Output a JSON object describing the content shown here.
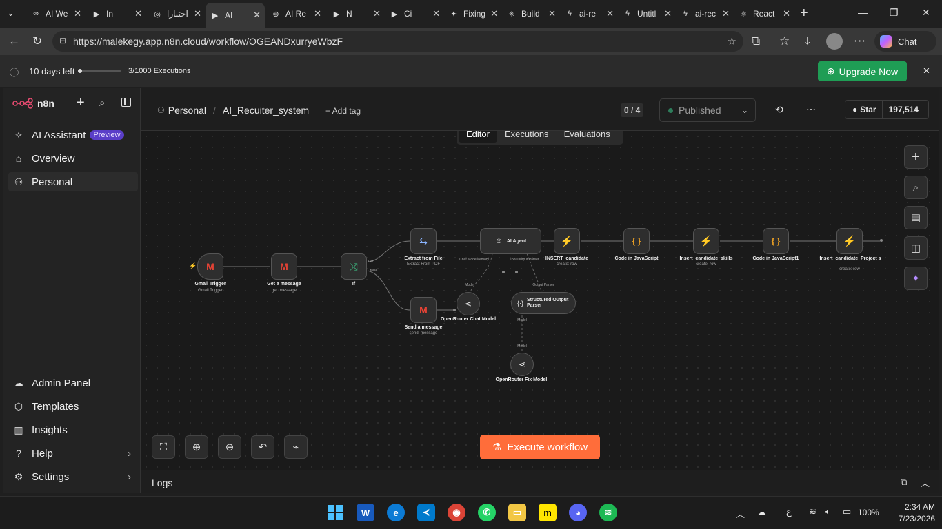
{
  "browser": {
    "tabs": [
      {
        "title": "AI We",
        "icon": "ai-favicon"
      },
      {
        "title": "In",
        "icon": "video-favicon"
      },
      {
        "title": "اختبارا",
        "icon": "quiz-favicon"
      },
      {
        "title": "AI",
        "icon": "video-favicon"
      },
      {
        "title": "AI Re",
        "icon": "chatgpt-favicon"
      },
      {
        "title": "N",
        "icon": "video-favicon"
      },
      {
        "title": "Ci",
        "icon": "video-favicon"
      },
      {
        "title": "Fixing",
        "icon": "gemini-favicon"
      },
      {
        "title": "Build",
        "icon": "claude-favicon"
      },
      {
        "title": "ai-re",
        "icon": "bolt-favicon"
      },
      {
        "title": "Untitl",
        "icon": "n8n-favicon"
      },
      {
        "title": "ai-rec",
        "icon": "bolt-favicon"
      },
      {
        "title": "React",
        "icon": "react-favicon"
      }
    ],
    "url": "https://malekegy.app.n8n.cloud/workflow/OGEANDxurryeWbzF",
    "chat_label": "Chat"
  },
  "banner": {
    "trial": "10 days left",
    "executions": "3/1000 Executions",
    "upgrade": "Upgrade Now"
  },
  "sidebar": {
    "brand": "n8n",
    "items": [
      {
        "label": "AI Assistant",
        "badge": "Preview",
        "icon": "sparkle-icon"
      },
      {
        "label": "Overview",
        "icon": "home-icon"
      },
      {
        "label": "Personal",
        "icon": "user-icon"
      }
    ],
    "bottom": [
      {
        "label": "Admin Panel",
        "icon": "cloud-icon"
      },
      {
        "label": "Templates",
        "icon": "box-icon"
      },
      {
        "label": "Insights",
        "icon": "chart-icon"
      },
      {
        "label": "Help",
        "icon": "help-icon"
      },
      {
        "label": "Settings",
        "icon": "gear-icon"
      }
    ]
  },
  "header": {
    "project": "Personal",
    "workflow_name": "AI_Recuiter_system",
    "add_tag": "+ Add tag",
    "counter": "0 / 4",
    "published": "Published",
    "star": "Star",
    "star_count": "197,514"
  },
  "canvas_tabs": [
    "Editor",
    "Executions",
    "Evaluations"
  ],
  "nodes": {
    "gmail_trigger": {
      "label": "Gmail Trigger",
      "sub": "Gmail Trigger"
    },
    "get_message": {
      "label": "Get a message",
      "sub": "get: message"
    },
    "if": {
      "label": "If",
      "true": "true",
      "false": "false"
    },
    "extract": {
      "label": "Extract from File",
      "sub": "Extract From PDF"
    },
    "send_message": {
      "label": "Send a message",
      "sub": "send: message"
    },
    "ai_agent": {
      "label": "AI Agent",
      "ports": [
        "Chat Model",
        "Memory",
        "Tool",
        "Output Parser"
      ]
    },
    "openrouter_chat": {
      "label": "OpenRouter Chat Model",
      "port": "Model"
    },
    "structured_parser": {
      "label": "Structured Output Parser",
      "port_top": "Output Parser",
      "port_bottom": "Model"
    },
    "openrouter_fix": {
      "label": "OpenRouter Fix Model",
      "port": "Model"
    },
    "insert_candidate": {
      "label": "INSERT_candidate",
      "sub": "create: row"
    },
    "code_js": {
      "label": "Code in JavaScript"
    },
    "insert_skills": {
      "label": "Insert_candidate_skills",
      "sub": "create: row"
    },
    "code_js1": {
      "label": "Code in JavaScript1"
    },
    "insert_project": {
      "label": "Insert_candidate_Project s",
      "sub": "create: row"
    }
  },
  "execute_button": "Execute workflow",
  "logs_label": "Logs",
  "taskbar": {
    "language": "ع",
    "battery": "100%",
    "time": "2:34 AM",
    "date": "7/23/2026"
  },
  "colors": {
    "accent": "#ff6d3a",
    "upgrade": "#1f9d55",
    "supabase": "#3ecf8e",
    "code": "#f5a623",
    "preview_badge": "#5a3ec8"
  }
}
